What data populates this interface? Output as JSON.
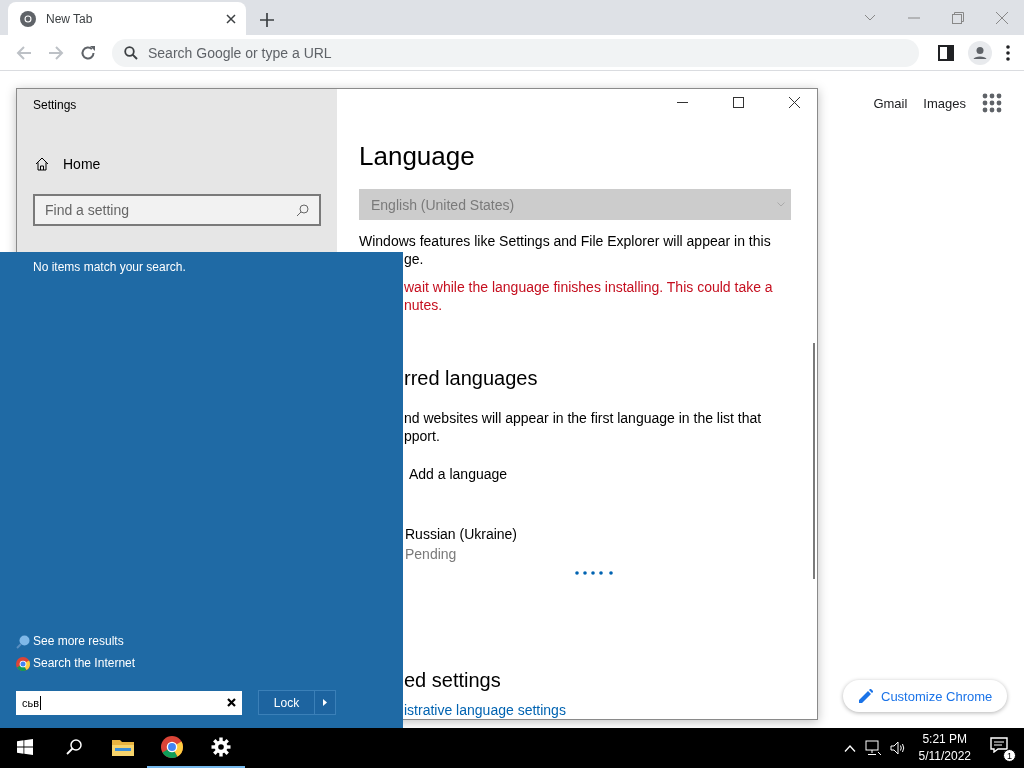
{
  "browser": {
    "tab": {
      "title": "New Tab"
    },
    "omnibox": {
      "placeholder": "Search Google or type a URL"
    },
    "links": [
      "Gmail",
      "Images"
    ],
    "customize_button": "Customize Chrome"
  },
  "settings_window": {
    "title": "Settings",
    "home": "Home",
    "search_placeholder": "Find a setting",
    "heading": "Language",
    "display_language": {
      "value": "English (United States)",
      "disabled": true
    },
    "description_lines": [
      "Windows features like Settings and File Explorer will appear in this",
      "ge."
    ],
    "warning_lines": [
      "wait while the language finishes installing. This could take a",
      "nutes."
    ],
    "preferred_heading": "rred languages",
    "preferred_lines": [
      "nd websites will appear in the first language in the list that",
      "pport."
    ],
    "languages": [
      {
        "kind": "add",
        "name": "Add a language"
      },
      {
        "kind": "installing",
        "name": "Russian (Ukraine)",
        "status": "Pending"
      }
    ],
    "related_heading": "ed settings",
    "related_link": "istrative language settings"
  },
  "start_search": {
    "message": "No items match your search.",
    "links": [
      {
        "kind": "search",
        "label": "See more results"
      },
      {
        "kind": "web",
        "label": "Search the Internet"
      }
    ],
    "query": "сьв",
    "power_button": "Lock"
  },
  "taskbar": {
    "apps": [
      {
        "kind": "start",
        "running": false
      },
      {
        "kind": "search",
        "running": false
      },
      {
        "kind": "explorer",
        "running": false
      },
      {
        "kind": "chrome",
        "running": true
      },
      {
        "kind": "settings",
        "running": true
      }
    ],
    "time": "5:21 PM",
    "date": "5/11/2022",
    "notifications": "1"
  }
}
